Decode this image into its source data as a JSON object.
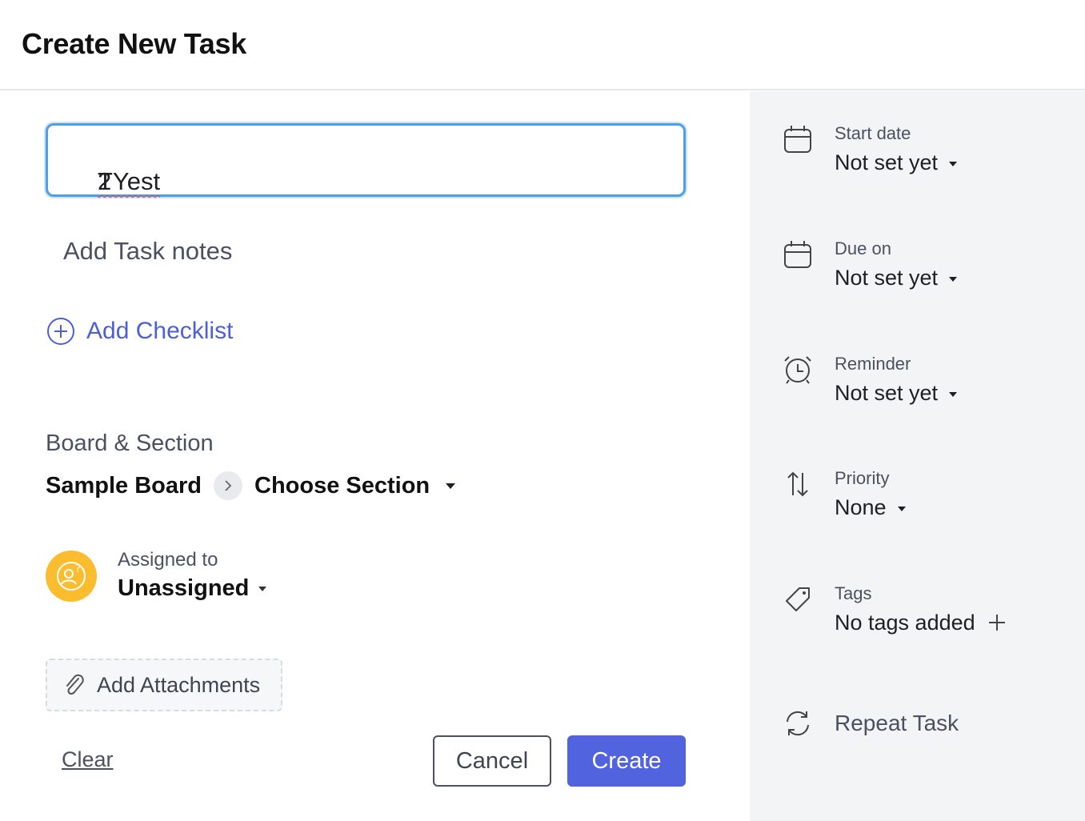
{
  "header": {
    "title": "Create New Task"
  },
  "task": {
    "title_word1": "TYest",
    "title_word2": " 2",
    "notes_placeholder": "Add Task notes",
    "add_checklist_label": "Add Checklist"
  },
  "board_section": {
    "label": "Board & Section",
    "board": "Sample Board",
    "section": "Choose Section"
  },
  "assignee": {
    "label": "Assigned to",
    "value": "Unassigned"
  },
  "attachments": {
    "label": "Add Attachments"
  },
  "actions": {
    "clear": "Clear",
    "cancel": "Cancel",
    "create": "Create"
  },
  "sidebar": {
    "start_date": {
      "label": "Start date",
      "value": "Not set yet",
      "icon": "calendar-icon"
    },
    "due_on": {
      "label": "Due on",
      "value": "Not set yet",
      "icon": "calendar-icon"
    },
    "reminder": {
      "label": "Reminder",
      "value": "Not set yet",
      "icon": "alarm-clock-icon"
    },
    "priority": {
      "label": "Priority",
      "value": "None",
      "icon": "sort-arrows-icon"
    },
    "tags": {
      "label": "Tags",
      "value": "No tags added",
      "icon": "tag-icon"
    },
    "repeat": {
      "label": "Repeat Task",
      "icon": "repeat-icon"
    }
  },
  "colors": {
    "accent": "#5263e0",
    "focus_border": "#4f9fe8",
    "avatar": "#fbbd2e",
    "sidebar_bg": "#f3f4f6"
  }
}
